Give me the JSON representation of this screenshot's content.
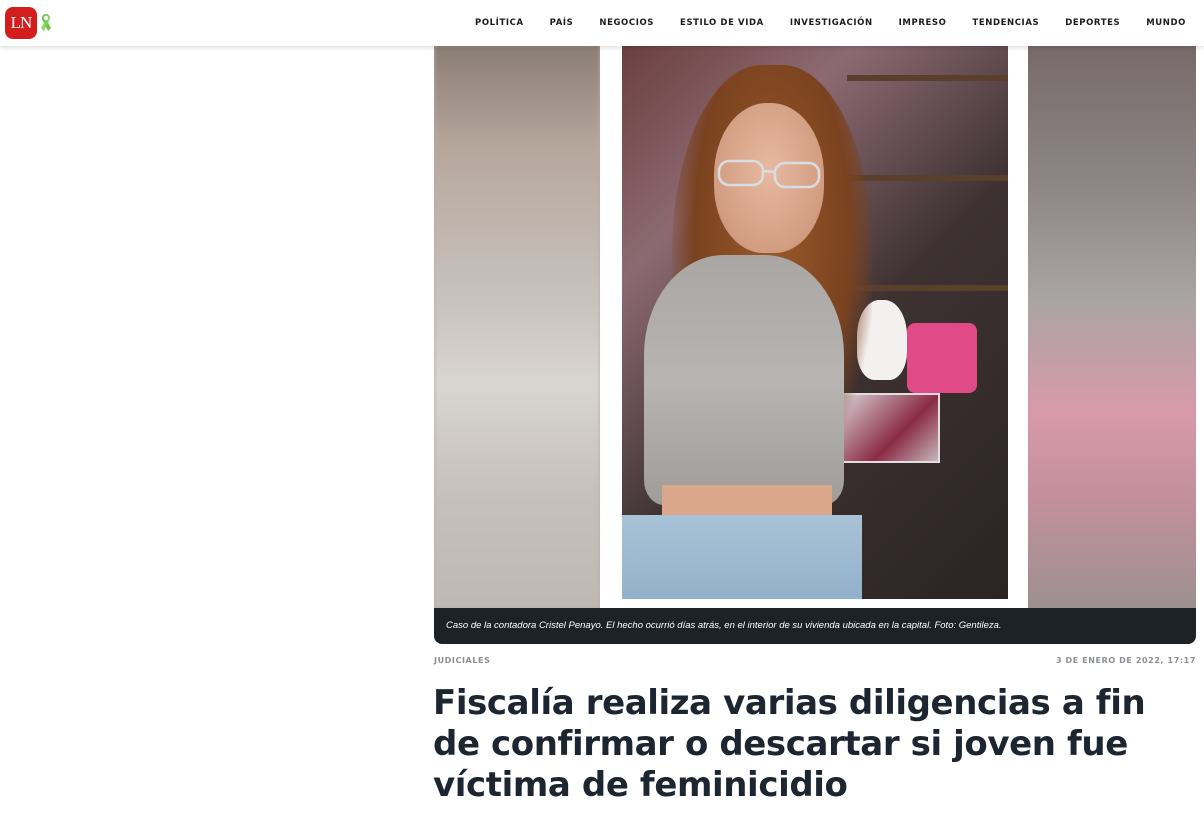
{
  "site": {
    "logo_text": "LN",
    "ribbon_icon": "green-awareness-ribbon-icon",
    "brand_color": "#d41e1e",
    "ribbon_color": "#6cc24a"
  },
  "nav": {
    "items": [
      {
        "label": "POLÍTICA"
      },
      {
        "label": "PAÍS"
      },
      {
        "label": "NEGOCIOS"
      },
      {
        "label": "ESTILO DE VIDA"
      },
      {
        "label": "INVESTIGACIÓN"
      },
      {
        "label": "IMPRESO"
      },
      {
        "label": "TENDENCIAS"
      },
      {
        "label": "DEPORTES"
      },
      {
        "label": "MUNDO"
      }
    ]
  },
  "article": {
    "image_caption": "Caso de la contadora Cristel Penayo. El hecho ocurrió días atrás, en el interior de su vivienda ubicada en la capital. Foto: Gentileza.",
    "section": "JUDICIALES",
    "date": "3 DE ENERO DE 2022, 17:17",
    "headline": "Fiscalía realiza varias diligencias a fin de confirmar o descartar si joven fue víctima de feminicidio",
    "caption_bg": "#1d2227",
    "headline_color": "#1c2530"
  }
}
